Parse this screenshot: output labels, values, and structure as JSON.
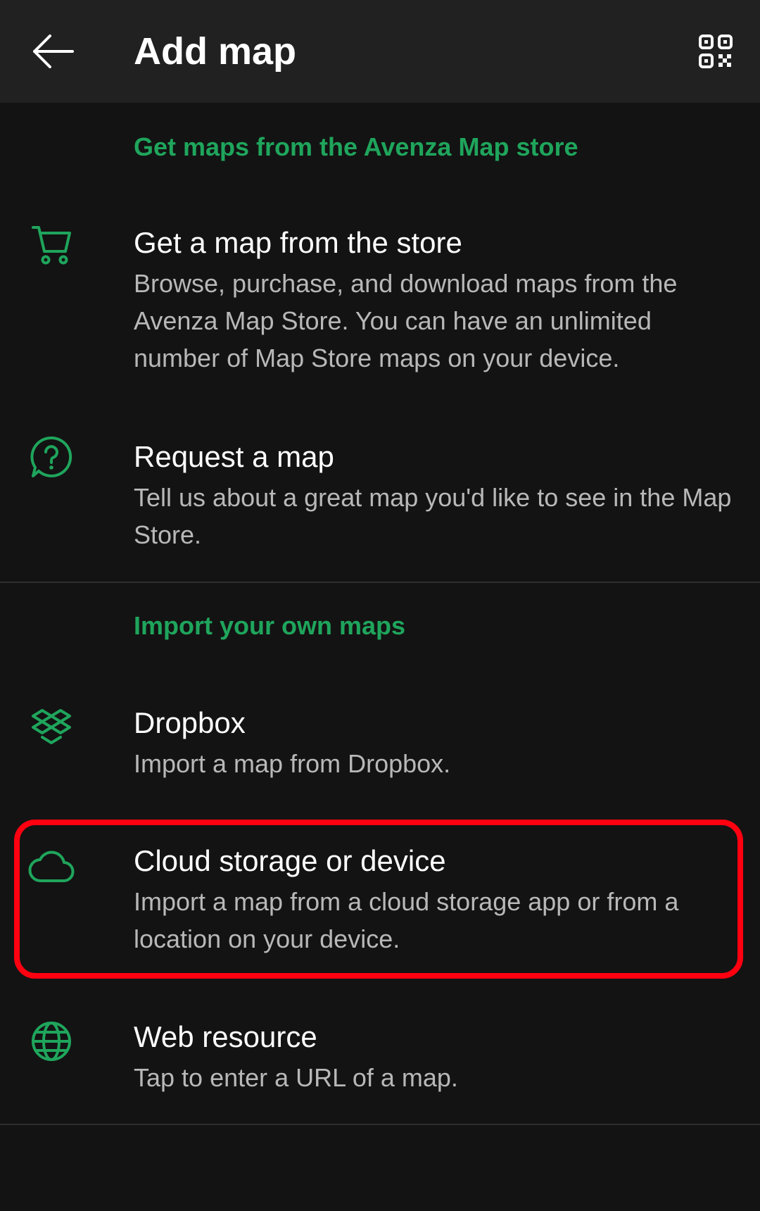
{
  "header": {
    "title": "Add map",
    "back_icon": "arrow-left-icon",
    "qr_icon": "qr-code-icon"
  },
  "store_section": {
    "header": "Get maps from the Avenza Map store",
    "items": [
      {
        "icon": "shopping-cart-icon",
        "title": "Get a map from the store",
        "description": "Browse, purchase, and download maps from the Avenza Map Store. You can have an unlimited number of Map Store maps on your device."
      },
      {
        "icon": "question-bubble-icon",
        "title": "Request a map",
        "description": "Tell us about a great map you'd like to see in the Map Store."
      }
    ]
  },
  "import_section": {
    "header": "Import your own maps",
    "items": [
      {
        "icon": "dropbox-icon",
        "title": "Dropbox",
        "description": "Import a map from Dropbox."
      },
      {
        "icon": "cloud-icon",
        "title": "Cloud storage or device",
        "description": "Import a map from a cloud storage app or from a location on your device."
      },
      {
        "icon": "globe-icon",
        "title": "Web resource",
        "description": "Tap to enter a URL of a map."
      }
    ]
  },
  "colors": {
    "background": "#131313",
    "topbar": "#212121",
    "accent_green": "#1fa55c",
    "highlight_red": "#ff0010",
    "description_gray": "#b8b8b8"
  }
}
